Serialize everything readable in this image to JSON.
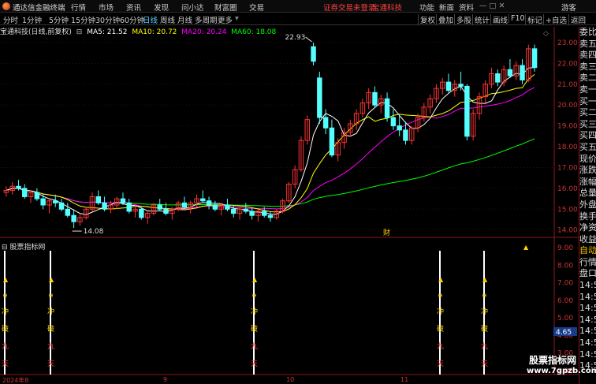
{
  "menubar": {
    "app_title": "通达信金融终端",
    "menus": [
      "行情",
      "市场",
      "资讯",
      "发现",
      "问小达",
      "财富圈",
      "交易"
    ],
    "login_notice": "证券交易未登录",
    "stock_name": "宝通科技",
    "right_items": [
      "功能",
      "新面",
      "资料",
      "游客"
    ]
  },
  "toolbar": {
    "periods": [
      "分时",
      "1分钟",
      "5分钟",
      "15分钟",
      "30分钟",
      "60分钟",
      "日线",
      "周线",
      "月线",
      "多周期",
      "更多"
    ],
    "active_period": "日线",
    "right_tools": [
      "复权",
      "叠加",
      "多股",
      "统计",
      "画线",
      "F10",
      "标记",
      "+自选",
      "返回"
    ]
  },
  "ma_bar": {
    "title": "宝通科技(日线,前复权)",
    "ma5": "MA5: 21.52",
    "ma10": "MA10: 20.72",
    "ma20": "MA20: 20.24",
    "ma60": "MA60: 18.08",
    "colors": {
      "ma5": "#ffffff",
      "ma10": "#ffff00",
      "ma20": "#ff00ff",
      "ma60": "#00ff00"
    }
  },
  "price_axis": [
    "23.00",
    "22.00",
    "21.00",
    "20.00",
    "19.00",
    "18.00",
    "17.00",
    "16.00",
    "15.00",
    "14.00"
  ],
  "annotations": {
    "high": "22.93",
    "low": "14.08",
    "finance_marker": "财"
  },
  "sidebar": {
    "top_small": "1000",
    "items": [
      "委比",
      "卖五",
      "卖四",
      "卖三",
      "卖二",
      "卖一",
      "买一",
      "买二",
      "买三",
      "买四",
      "买五",
      "现价",
      "涨跌",
      "涨幅",
      "总量",
      "外盘",
      "换手",
      "净资",
      "收益",
      "自动",
      "行情",
      "盘口",
      "14:5",
      "14:5",
      "14:5",
      "14:5",
      "14:5",
      "14:5",
      "14:5",
      "14:5"
    ]
  },
  "indicator": {
    "title": "股票指标网",
    "axis": [
      "9.00",
      "8.00",
      "7.00",
      "6.00",
      "5.00",
      "4.00",
      "3.00",
      "2.00"
    ],
    "current_value": "4.65",
    "signal_chars": [
      "冲",
      "破",
      "九",
      "天"
    ]
  },
  "timeline": {
    "labels": [
      "2024年8",
      "9",
      "10",
      "11"
    ]
  },
  "watermark": {
    "line1": "股票指标网",
    "line2": "www.7gpzb.com"
  },
  "chart_data": {
    "type": "candlestick",
    "ylim": [
      13.8,
      23.3
    ],
    "up_color": "#ff3333",
    "down_color": "#54ffff",
    "candles": [
      [
        15.8,
        16.1,
        15.6,
        15.9
      ],
      [
        15.9,
        16.3,
        15.7,
        16.1
      ],
      [
        16.1,
        16.4,
        15.9,
        16.0
      ],
      [
        16.0,
        16.2,
        15.5,
        15.6
      ],
      [
        15.6,
        15.9,
        15.3,
        15.8
      ],
      [
        15.8,
        16.0,
        15.4,
        15.5
      ],
      [
        15.5,
        15.7,
        15.0,
        15.2
      ],
      [
        15.2,
        15.5,
        14.8,
        15.4
      ],
      [
        15.4,
        15.7,
        15.1,
        15.3
      ],
      [
        15.3,
        15.5,
        14.9,
        15.0
      ],
      [
        15.0,
        15.3,
        14.6,
        14.7
      ],
      [
        14.7,
        15.0,
        14.1,
        14.4
      ],
      [
        14.4,
        14.8,
        14.2,
        14.6
      ],
      [
        14.6,
        15.1,
        14.5,
        15.0
      ],
      [
        15.0,
        15.8,
        14.9,
        15.6
      ],
      [
        15.6,
        15.9,
        15.2,
        15.3
      ],
      [
        15.3,
        15.6,
        14.9,
        15.0
      ],
      [
        15.0,
        15.4,
        14.8,
        15.2
      ],
      [
        15.2,
        15.6,
        15.0,
        15.5
      ],
      [
        15.5,
        15.8,
        15.2,
        15.3
      ],
      [
        15.3,
        15.5,
        14.8,
        14.9
      ],
      [
        14.9,
        15.2,
        14.6,
        15.0
      ],
      [
        15.0,
        15.1,
        14.5,
        14.6
      ],
      [
        14.6,
        14.9,
        14.3,
        14.8
      ],
      [
        14.8,
        15.3,
        14.7,
        15.2
      ],
      [
        15.2,
        15.5,
        14.9,
        15.0
      ],
      [
        15.0,
        15.3,
        14.7,
        14.8
      ],
      [
        14.8,
        15.1,
        14.5,
        15.0
      ],
      [
        15.0,
        15.4,
        14.9,
        15.3
      ],
      [
        15.3,
        15.6,
        15.0,
        15.1
      ],
      [
        15.1,
        15.4,
        14.8,
        15.3
      ],
      [
        15.3,
        15.7,
        15.1,
        15.5
      ],
      [
        15.5,
        15.9,
        15.3,
        15.4
      ],
      [
        15.4,
        15.6,
        15.0,
        15.2
      ],
      [
        15.2,
        15.4,
        14.9,
        15.0
      ],
      [
        15.0,
        15.3,
        14.7,
        15.2
      ],
      [
        15.2,
        15.5,
        14.9,
        15.0
      ],
      [
        15.0,
        15.2,
        14.6,
        14.8
      ],
      [
        14.8,
        15.1,
        14.5,
        15.0
      ],
      [
        15.0,
        15.3,
        14.8,
        14.9
      ],
      [
        14.9,
        15.1,
        14.5,
        14.7
      ],
      [
        14.7,
        15.0,
        14.4,
        14.9
      ],
      [
        14.9,
        15.1,
        14.6,
        14.7
      ],
      [
        14.7,
        14.9,
        14.4,
        14.6
      ],
      [
        14.6,
        15.0,
        14.5,
        14.9
      ],
      [
        14.9,
        15.5,
        14.8,
        15.4
      ],
      [
        15.4,
        16.3,
        15.3,
        16.2
      ],
      [
        16.2,
        17.1,
        16.0,
        16.9
      ],
      [
        16.9,
        18.5,
        16.8,
        18.3
      ],
      [
        18.3,
        19.5,
        18.1,
        19.3
      ],
      [
        22.8,
        23.0,
        21.9,
        22.1
      ],
      [
        21.3,
        21.6,
        19.1,
        19.4
      ],
      [
        19.4,
        19.8,
        18.6,
        18.9
      ],
      [
        18.9,
        19.3,
        17.5,
        17.6
      ],
      [
        17.6,
        18.4,
        17.3,
        18.2
      ],
      [
        18.2,
        18.9,
        17.9,
        18.7
      ],
      [
        18.7,
        19.3,
        18.5,
        19.1
      ],
      [
        19.1,
        19.8,
        18.8,
        19.6
      ],
      [
        19.6,
        20.3,
        19.4,
        20.1
      ],
      [
        20.1,
        20.8,
        19.8,
        20.6
      ],
      [
        20.6,
        20.9,
        19.9,
        20.0
      ],
      [
        20.0,
        20.5,
        19.6,
        20.3
      ],
      [
        20.3,
        20.6,
        19.2,
        19.4
      ],
      [
        19.4,
        19.8,
        18.8,
        19.0
      ],
      [
        19.0,
        19.5,
        18.5,
        18.8
      ],
      [
        18.8,
        19.2,
        18.1,
        18.3
      ],
      [
        18.3,
        19.0,
        18.1,
        18.9
      ],
      [
        18.9,
        19.6,
        18.7,
        19.4
      ],
      [
        19.4,
        20.1,
        19.2,
        19.9
      ],
      [
        19.9,
        20.5,
        19.6,
        20.3
      ],
      [
        20.3,
        21.0,
        20.1,
        20.8
      ],
      [
        20.8,
        21.3,
        20.5,
        21.1
      ],
      [
        21.1,
        21.5,
        20.6,
        20.7
      ],
      [
        20.7,
        21.2,
        20.4,
        21.0
      ],
      [
        21.0,
        21.6,
        20.7,
        20.9
      ],
      [
        20.9,
        21.0,
        18.3,
        18.5
      ],
      [
        18.5,
        19.8,
        18.3,
        19.6
      ],
      [
        19.6,
        20.6,
        19.3,
        20.4
      ],
      [
        20.4,
        21.2,
        20.1,
        21.0
      ],
      [
        21.0,
        21.8,
        20.8,
        21.5
      ],
      [
        21.5,
        21.7,
        20.9,
        21.1
      ],
      [
        21.1,
        21.9,
        20.9,
        21.7
      ],
      [
        21.7,
        22.2,
        21.3,
        21.4
      ],
      [
        21.4,
        22.1,
        21.2,
        21.9
      ],
      [
        21.9,
        22.2,
        21.0,
        21.2
      ],
      [
        21.2,
        22.9,
        21.1,
        22.7
      ],
      [
        22.7,
        22.9,
        21.6,
        21.8
      ]
    ]
  }
}
